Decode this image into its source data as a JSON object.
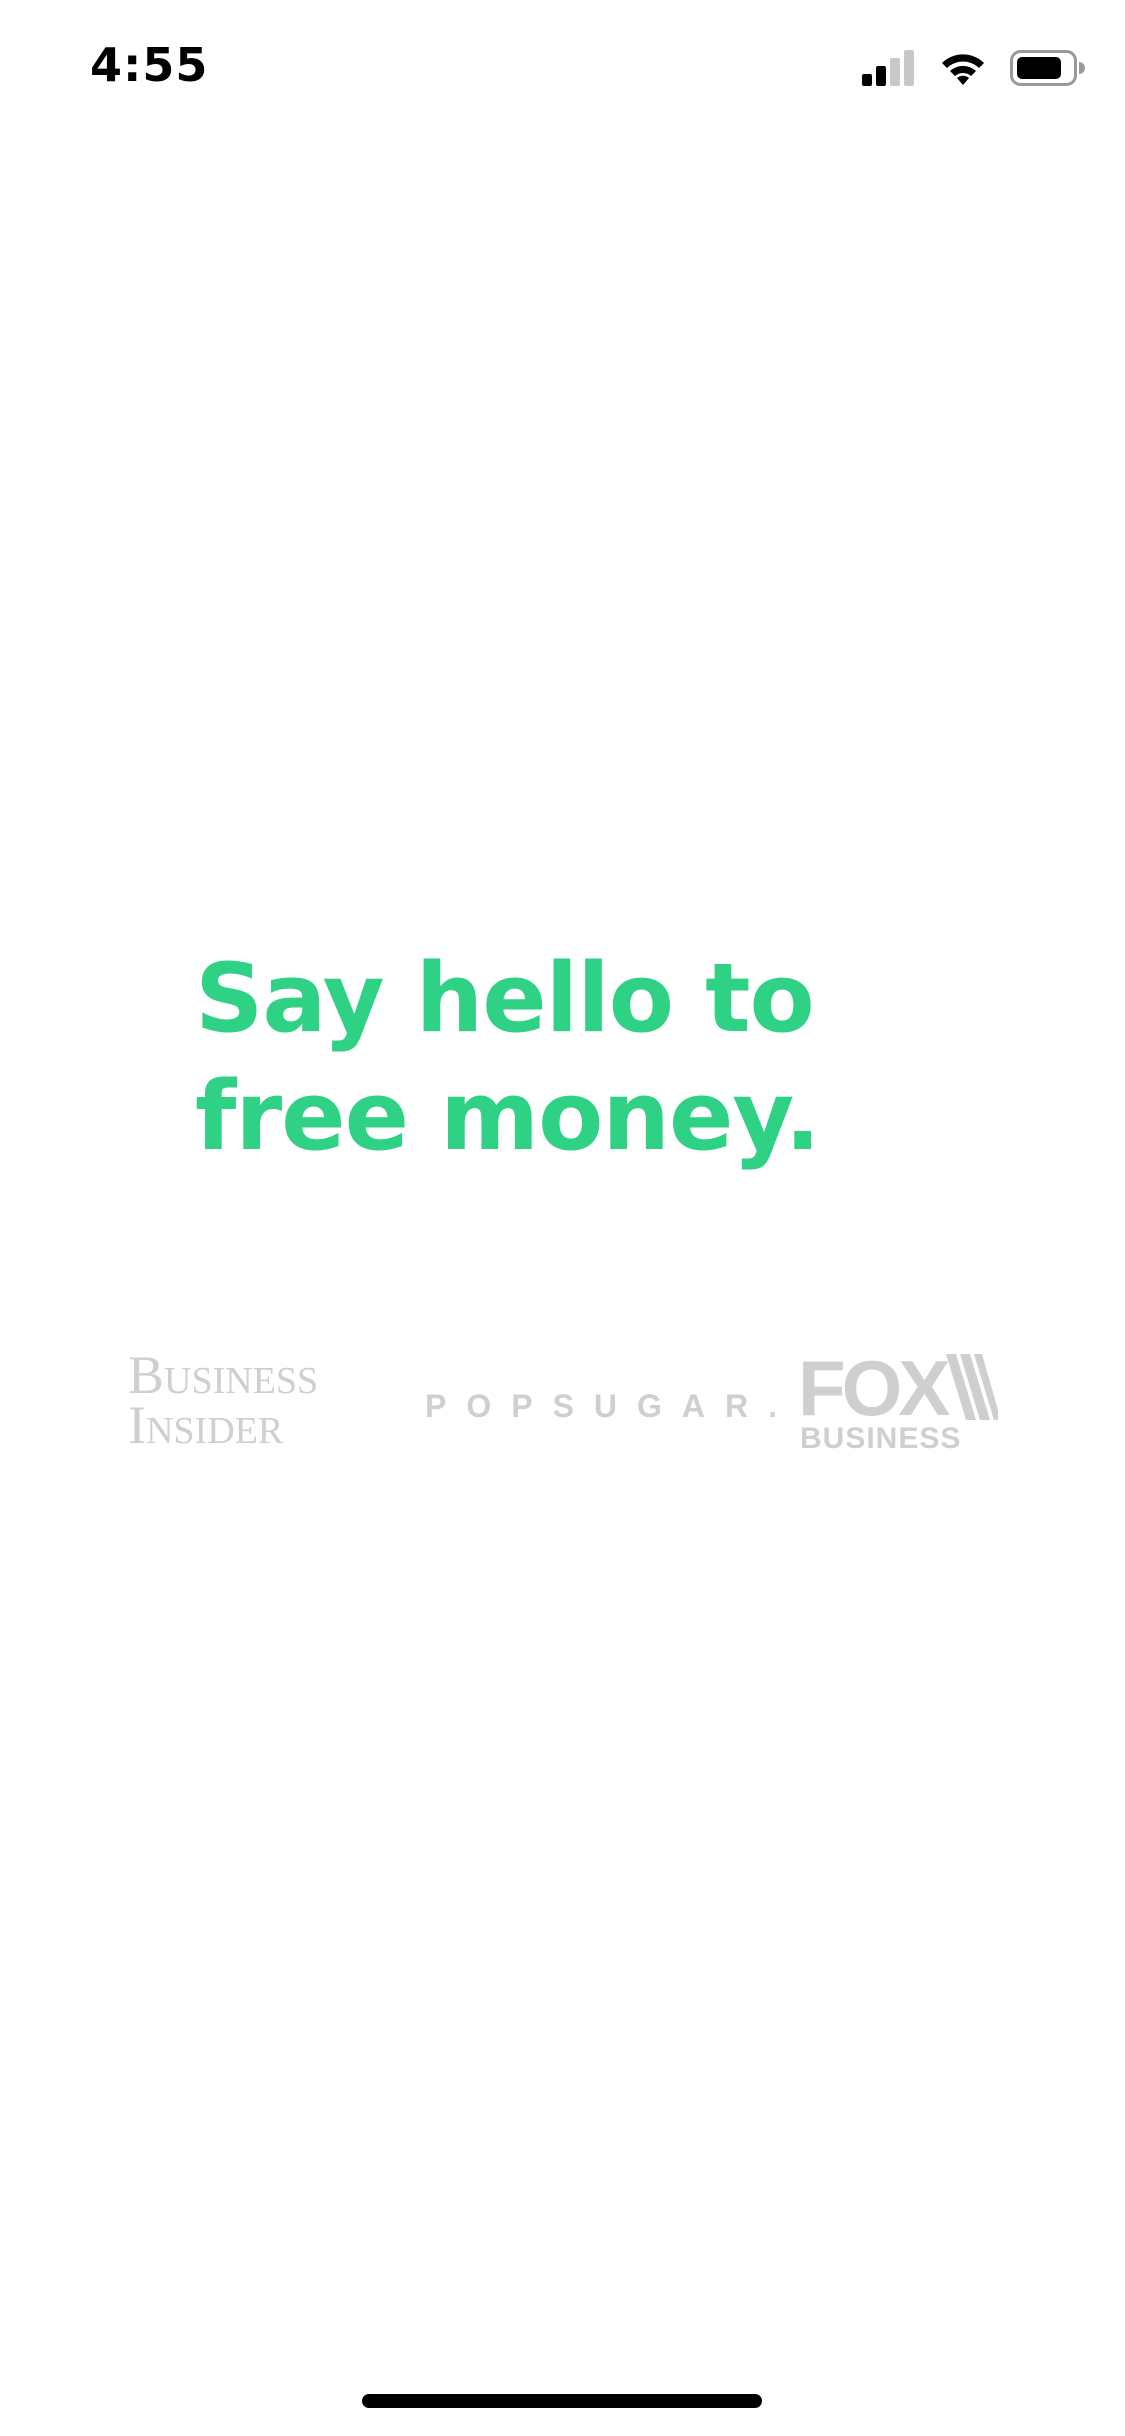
{
  "status_bar": {
    "time": "4:55",
    "icons": [
      "signal-icon",
      "wifi-icon",
      "battery-icon"
    ]
  },
  "headline": "Say hello to free money.",
  "press_logos": {
    "business_insider": {
      "line1": "Business",
      "line2": "Insider"
    },
    "popsugar": "POPSUGAR.",
    "fox_business": {
      "word": "FOX",
      "sub": "BUSINESS"
    }
  },
  "colors": {
    "accent_green": "#2fd184",
    "logo_gray": "#cfcfcf",
    "background": "#ffffff"
  }
}
